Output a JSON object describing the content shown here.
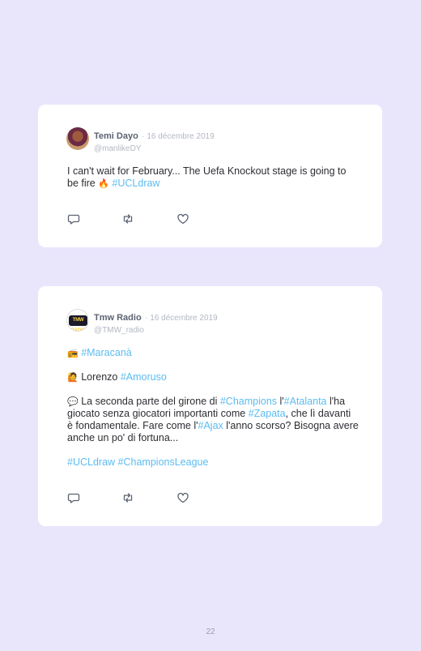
{
  "tweets": [
    {
      "name": "Temi Dayo",
      "date": "· 16 décembre 2019",
      "handle": "@manlikeDY",
      "text_a": "I can't wait for February... The Uefa Knockout stage is going to be fire ",
      "emoji_a": "🔥",
      "tag_a": "#UCLdraw"
    },
    {
      "name": "Tmw Radio",
      "date": "· 16 décembre 2019",
      "handle": "@TMW_radio",
      "avatar_logo": "TMW RADIO",
      "l1_emoji": "📻",
      "l1_tag": "#Maracanà",
      "l2_emoji": "🙋",
      "l2_text": "Lorenzo ",
      "l2_tag": "#Amoruso",
      "l3_emoji": "💬",
      "l3_text1": "La seconda parte del girone di ",
      "l3_tag1": "#Champions",
      "l3_text2": " l'",
      "l3_tag2": "#Atalanta",
      "l3_text3": " l'ha giocato senza giocatori importanti come ",
      "l3_tag3": "#Zapata",
      "l3_text4": ", che lì davanti è fondamentale. Fare come l'",
      "l3_tag4": "#Ajax",
      "l3_text5": " l'anno scorso? Bisogna avere anche un po' di fortuna...",
      "l4_tag1": "#UCLdraw",
      "l4_sep": " ",
      "l4_tag2": "#ChampionsLeague"
    }
  ],
  "page_number": "22",
  "colors": {
    "background": "#e9e6fc",
    "card": "#ffffff",
    "hashtag": "#5bbcf0",
    "muted": "#b2b8c2"
  },
  "icons": [
    "reply-icon",
    "retweet-icon",
    "like-icon"
  ]
}
